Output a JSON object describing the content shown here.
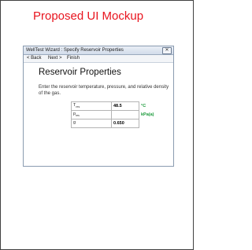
{
  "mockup_heading": "Proposed UI Mockup",
  "window": {
    "title": "WellTest Wizard : Specify Reservoir Properties",
    "close_glyph": "✕",
    "menu": [
      "< Back",
      "Next >",
      "Finish"
    ]
  },
  "content": {
    "title": "Reservoir Properties",
    "description": "Enter the reservoir temperature, pressure, and relative density of the gas.",
    "properties": [
      {
        "symbol": "T",
        "subscript": "res",
        "value": "48.5",
        "unit": "°C"
      },
      {
        "symbol": "p",
        "subscript": "res",
        "value": "",
        "unit": "kPa(a)"
      },
      {
        "symbol": "g",
        "subscript": "",
        "value": "0.650",
        "unit": ""
      }
    ]
  },
  "colors": {
    "heading": "#e8141e",
    "unit_text": "#1a9a3a",
    "window_border": "#8a9bb0"
  }
}
